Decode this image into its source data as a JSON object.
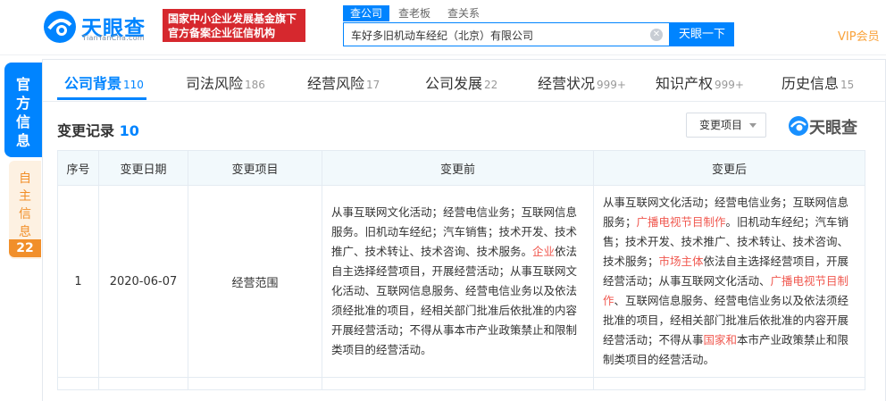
{
  "header": {
    "logo_text": "天眼查",
    "logo_sub": "TianYanCha.com",
    "banner_line1": "国家中小企业发展基金旗下",
    "banner_line2": "官方备案企业征信机构",
    "search_tabs": [
      "查公司",
      "查老板",
      "查关系"
    ],
    "search_value": "车好多旧机动车经纪（北京）有限公司",
    "search_button": "天眼一下",
    "vip": "VIP会员"
  },
  "side": {
    "official": [
      "官",
      "方",
      "信",
      "息"
    ],
    "self": [
      "自",
      "主",
      "信",
      "息"
    ],
    "self_count": "22"
  },
  "tabs": [
    {
      "label": "公司背景",
      "count": "110"
    },
    {
      "label": "司法风险",
      "count": "186"
    },
    {
      "label": "经营风险",
      "count": "17"
    },
    {
      "label": "公司发展",
      "count": "22"
    },
    {
      "label": "经营状况",
      "count": "999+"
    },
    {
      "label": "知识产权",
      "count": "999+"
    },
    {
      "label": "历史信息",
      "count": "15"
    }
  ],
  "section": {
    "title": "变更记录",
    "count": "10",
    "filter_label": "变更项目",
    "watermark": "天眼查"
  },
  "table": {
    "headers": [
      "序号",
      "变更日期",
      "变更项目",
      "变更前",
      "变更后"
    ],
    "rows": [
      {
        "index": "1",
        "date": "2020-06-07",
        "item": "经营范围",
        "before": [
          {
            "t": "从事互联网文化活动；经营电信业务；互联网信息服务。旧机动车经纪；汽车销售；技术开发、技术推广、技术转让、技术咨询、技术服务。"
          },
          {
            "t": "企业",
            "hl": true
          },
          {
            "t": "依法自主选择经营项目，开展经营活动；从事互联网文化活动、互联网信息服务、经营电信业务以及依法须经批准的项目，经相关部门批准后依批准的内容开展经营活动；不得从事本市产业政策禁止和限制类项目的经营活动。"
          }
        ],
        "after": [
          {
            "t": "从事互联网文化活动；经营电信业务；互联网信息服务；"
          },
          {
            "t": "广播电视节目制作",
            "hl": true
          },
          {
            "t": "。旧机动车经纪；汽车销售；技术开发、技术推广、技术转让、技术咨询、技术服务；"
          },
          {
            "t": "市场主体",
            "hl": true
          },
          {
            "t": "依法自主选择经营项目，开展经营活动；从事互联网文化活动、"
          },
          {
            "t": "广播电视节目制作",
            "hl": true
          },
          {
            "t": "、互联网信息服务、经营电信业务以及依法须经批准的项目，经相关部门批准后依批准的内容开展经营活动；不得从事"
          },
          {
            "t": "国家和",
            "hl": true
          },
          {
            "t": "本市产业政策禁止和限制类项目的经营活动。"
          }
        ]
      }
    ]
  }
}
